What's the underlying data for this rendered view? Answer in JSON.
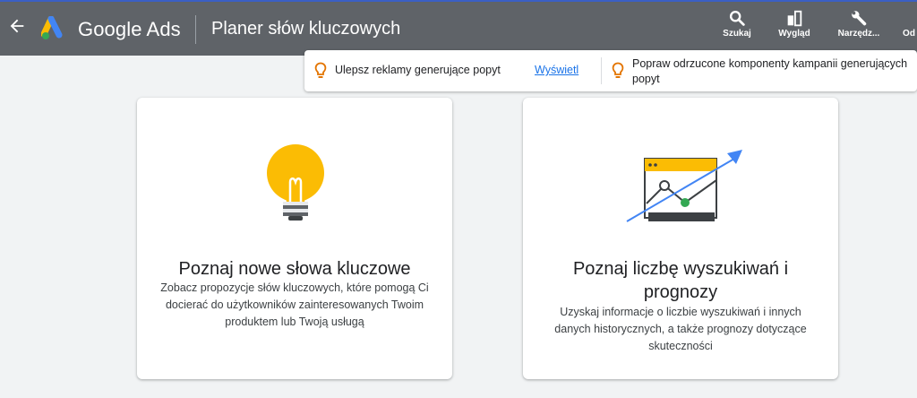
{
  "header": {
    "brand": "Google Ads",
    "page_title": "Planer słów kluczowych",
    "tools": [
      {
        "label": "Szukaj",
        "icon": "search-icon"
      },
      {
        "label": "Wygląd",
        "icon": "appearance-icon"
      },
      {
        "label": "Narzędz...",
        "icon": "wrench-icon"
      },
      {
        "label": "Od",
        "icon": "refresh-icon"
      }
    ]
  },
  "notifications": [
    {
      "text": "Ulepsz reklamy generujące popyt",
      "link": "Wyświetl",
      "icon": "lightbulb-outline-icon"
    },
    {
      "text": "Popraw odrzucone komponenty kampanii generujących popyt",
      "icon": "lightbulb-outline-icon"
    }
  ],
  "cards": [
    {
      "title": "Poznaj nowe słowa kluczowe",
      "description": "Zobacz propozycje słów kluczowych, które pomogą Ci docierać do użytkowników zainteresowanych Twoim produktem lub Twoją usługą",
      "icon": "lightbulb-illustration"
    },
    {
      "title": "Poznaj liczbę wyszukiwań i prognozy",
      "description": "Uzyskaj informacje o liczbie wyszukiwań i innych danych historycznych, a także prognozy dotyczące skuteczności",
      "icon": "trend-chart-illustration"
    }
  ],
  "colors": {
    "topbar": "#5f6368",
    "link": "#1a73e8",
    "bulb_yellow": "#fbbc04",
    "bulb_orange": "#e37400",
    "chart_blue": "#4285f4",
    "chart_green": "#34a853"
  }
}
